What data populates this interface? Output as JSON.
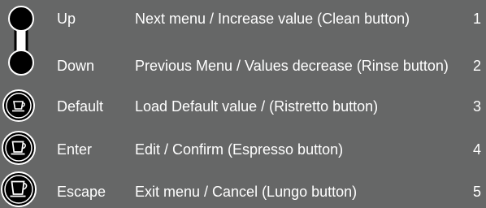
{
  "rows": [
    {
      "label": "Up",
      "description": "Next menu / Increase value (Clean button)",
      "number": "1",
      "icon": "up-circle-icon"
    },
    {
      "label": "Down",
      "description": "Previous Menu / Values decrease (Rinse button)",
      "number": "2",
      "icon": "down-circle-icon"
    },
    {
      "label": "Default",
      "description": "Load Default value / (Ristretto button)",
      "number": "3",
      "icon": "cup-small-icon"
    },
    {
      "label": "Enter",
      "description": "Edit / Confirm (Espresso button)",
      "number": "4",
      "icon": "cup-medium-icon"
    },
    {
      "label": "Escape",
      "description": "Exit menu / Cancel (Lungo button)",
      "number": "5",
      "icon": "cup-large-icon"
    }
  ],
  "colors": {
    "background": "#666767",
    "text": "#ffffff",
    "icon_fill": "#000000"
  }
}
